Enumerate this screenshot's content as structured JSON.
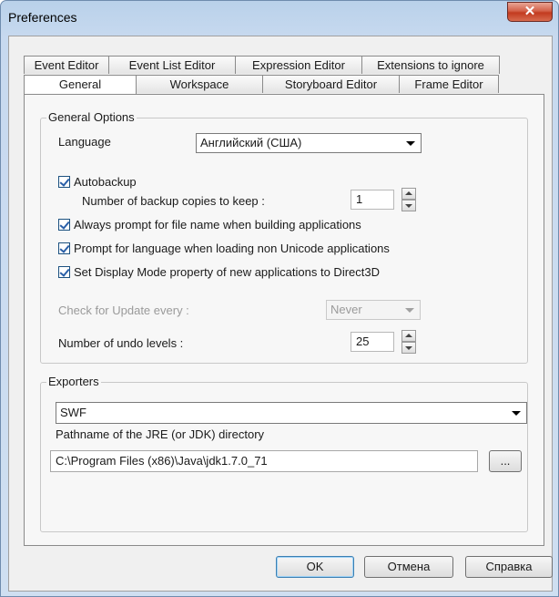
{
  "window": {
    "title": "Preferences",
    "close_glyph": "✕"
  },
  "tabs": {
    "top_row": [
      "Event Editor",
      "Event List Editor",
      "Expression Editor",
      "Extensions to ignore"
    ],
    "bottom_row": [
      "General",
      "Workspace",
      "Storyboard Editor",
      "Frame Editor"
    ],
    "active": "General"
  },
  "general_options": {
    "group_title": "General Options",
    "language_label": "Language",
    "language_value": "Английский (США)",
    "autobackup_label": "Autobackup",
    "autobackup_checked": true,
    "backup_copies_label": "Number of backup copies to keep :",
    "backup_copies_value": "1",
    "always_prompt_label": "Always prompt for file name when building applications",
    "always_prompt_checked": true,
    "prompt_language_label": "Prompt for language when loading non Unicode applications",
    "prompt_language_checked": true,
    "display_mode_label": "Set Display Mode property of new applications to Direct3D",
    "display_mode_checked": true,
    "check_update_label": "Check for Update every :",
    "check_update_value": "Never",
    "undo_levels_label": "Number of undo levels :",
    "undo_levels_value": "25"
  },
  "exporters": {
    "group_title": "Exporters",
    "exporter_value": "SWF",
    "jre_label": "Pathname of the JRE (or JDK) directory",
    "jre_path": "C:\\Program Files (x86)\\Java\\jdk1.7.0_71",
    "browse_label": "..."
  },
  "buttons": {
    "ok": "OK",
    "cancel": "Отмена",
    "help": "Справка"
  }
}
